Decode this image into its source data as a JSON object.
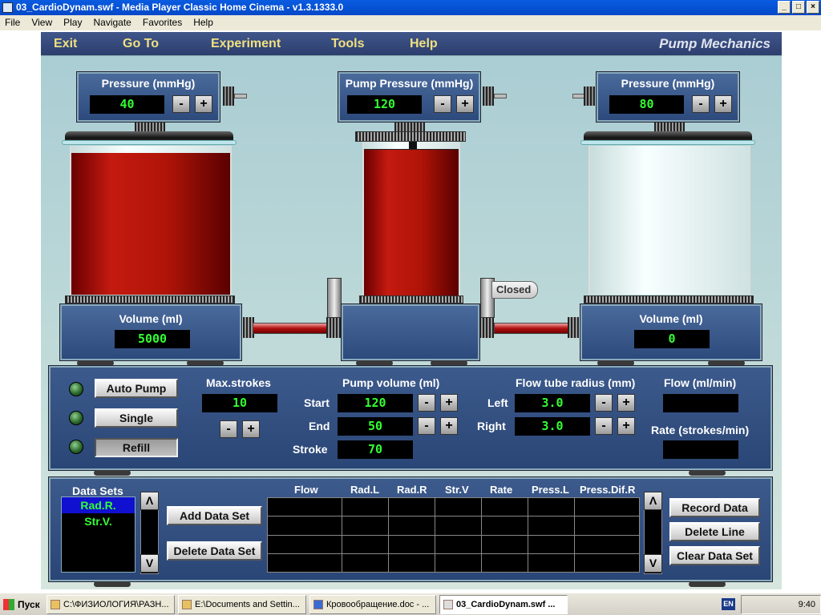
{
  "window": {
    "title": "03_CardioDynam.swf - Media Player Classic Home Cinema - v1.3.1333.0",
    "btn_min": "_",
    "btn_max": "□",
    "btn_close": "×"
  },
  "menu": [
    "File",
    "View",
    "Play",
    "Navigate",
    "Favorites",
    "Help"
  ],
  "nav": {
    "exit": "Exit",
    "goto": "Go To",
    "experiment": "Experiment",
    "tools": "Tools",
    "help": "Help",
    "brand": "Pump Mechanics"
  },
  "left_beaker": {
    "pressure_label": "Pressure (mmHg)",
    "pressure": "40",
    "volume_label": "Volume (ml)",
    "volume": "5000",
    "fill": 0.95
  },
  "pump": {
    "pressure_label": "Pump Pressure (mmHg)",
    "pressure": "120",
    "fill": 0.95
  },
  "right_beaker": {
    "pressure_label": "Pressure (mmHg)",
    "pressure": "80",
    "volume_label": "Volume (ml)",
    "volume": "0",
    "fill": 0.0
  },
  "valve_status": "Closed",
  "controls": {
    "auto_pump": "Auto Pump",
    "single": "Single",
    "refill": "Refill",
    "max_strokes_label": "Max.strokes",
    "max_strokes": "10",
    "pump_volume_label": "Pump volume (ml)",
    "start_label": "Start",
    "start": "120",
    "end_label": "End",
    "end": "50",
    "stroke_label": "Stroke",
    "stroke": "70",
    "flow_radius_label": "Flow tube radius (mm)",
    "left_label": "Left",
    "left": "3.0",
    "right_label": "Right",
    "right": "3.0",
    "flow_label": "Flow (ml/min)",
    "flow": "",
    "rate_label": "Rate (strokes/min)",
    "rate": ""
  },
  "datasets": {
    "title": "Data Sets",
    "items": [
      "Rad.R.",
      "Str.V."
    ],
    "add": "Add Data Set",
    "delete": "Delete Data Set",
    "columns": [
      "Flow",
      "Rad.L",
      "Rad.R",
      "Str.V",
      "Rate",
      "Press.L",
      "Press.Dif.R"
    ],
    "record": "Record Data",
    "delete_line": "Delete Line",
    "clear": "Clear Data Set"
  },
  "pm": {
    "minus": "-",
    "plus": "+"
  },
  "scroll": {
    "up": "Λ",
    "down": "V"
  },
  "taskbar": {
    "start": "Пуск",
    "tasks": [
      "C:\\ФИЗИОЛОГИЯ\\РАЗН...",
      "E:\\Documents and Settin...",
      "Кровообращение.doc - ...",
      "03_CardioDynam.swf ..."
    ],
    "lang": "EN",
    "clock": "9:40"
  }
}
